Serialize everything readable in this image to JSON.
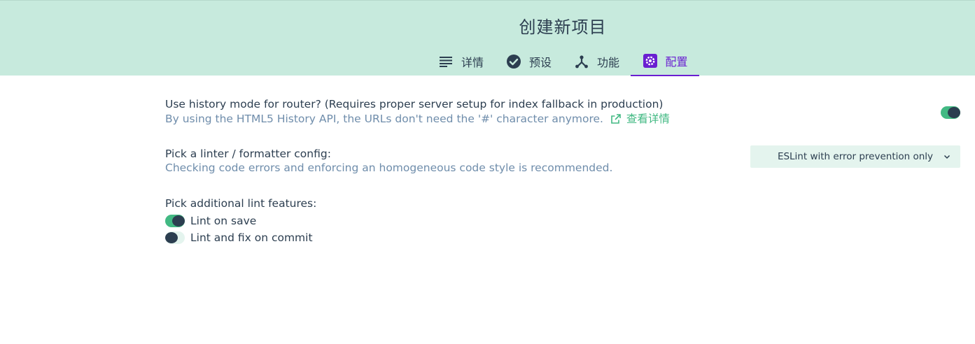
{
  "header": {
    "title": "创建新项目",
    "tabs": [
      {
        "label": "详情",
        "icon": "list-icon"
      },
      {
        "label": "预设",
        "icon": "check-circle-icon"
      },
      {
        "label": "功能",
        "icon": "fork-icon"
      },
      {
        "label": "配置",
        "icon": "settings-gear-icon",
        "active": true
      }
    ]
  },
  "router": {
    "label": "Use history mode for router? (Requires proper server setup for index fallback in production)",
    "description": "By using the HTML5 History API, the URLs don't need the '#' character anymore.",
    "link": "查看详情",
    "enabled": true
  },
  "linter": {
    "label": "Pick a linter / formatter config:",
    "description": "Checking code errors and enforcing an homogeneous code style is recommended.",
    "selected": "ESLint with error prevention only"
  },
  "lint_features": {
    "label": "Pick additional lint features:",
    "options": [
      {
        "label": "Lint on save",
        "enabled": true
      },
      {
        "label": "Lint and fix on commit",
        "enabled": false
      }
    ]
  },
  "colors": {
    "header_bg": "#c7eadd",
    "accent_green": "#42b983",
    "active_tab": "#6a1fd1",
    "text_dark": "#2c3e50",
    "text_muted": "#6f8dab"
  }
}
